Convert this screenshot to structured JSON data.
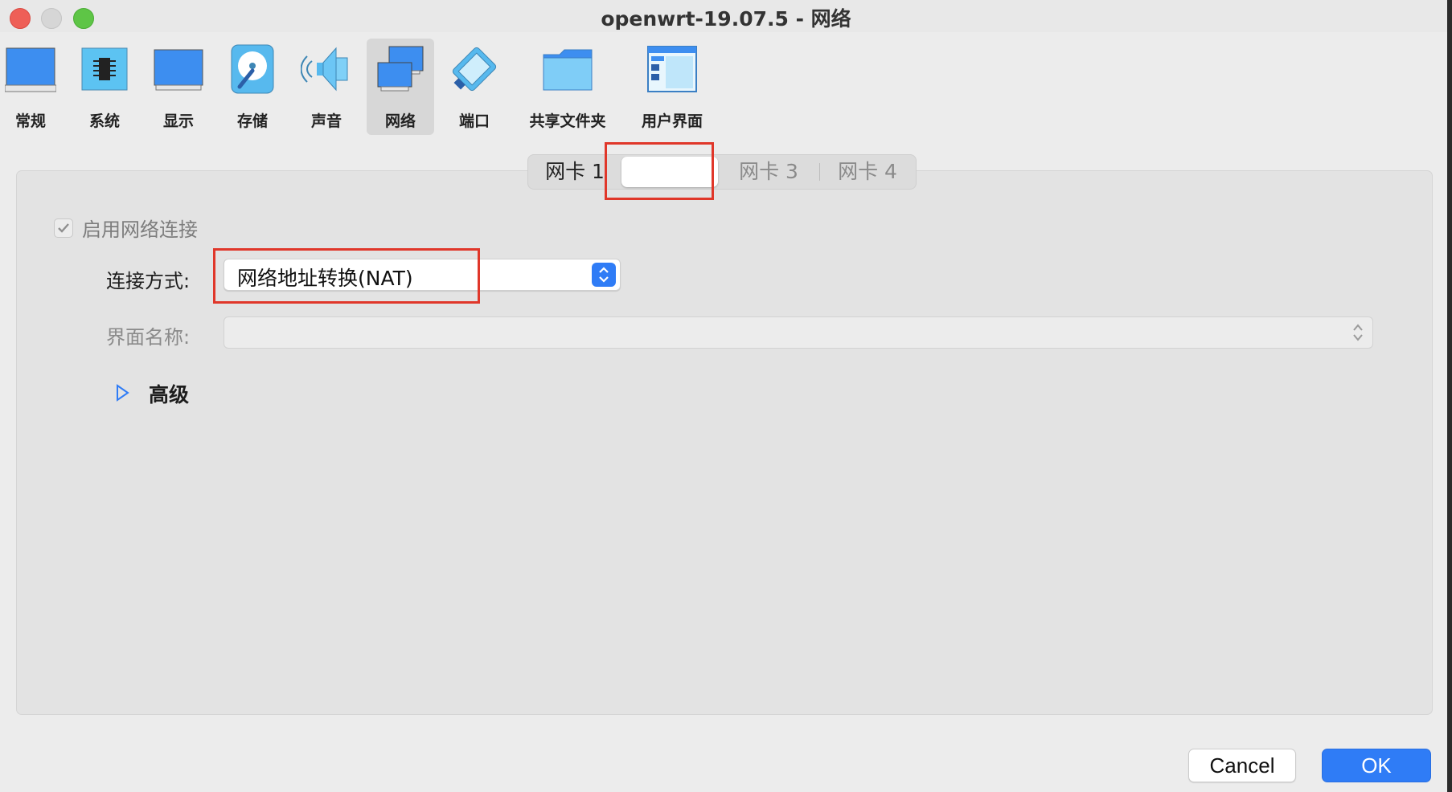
{
  "window": {
    "title": "openwrt-19.07.5 - 网络"
  },
  "toolbar": {
    "items": [
      {
        "label": "常规",
        "icon": "monitor-icon"
      },
      {
        "label": "系统",
        "icon": "chip-icon"
      },
      {
        "label": "显示",
        "icon": "display-icon"
      },
      {
        "label": "存储",
        "icon": "disk-icon"
      },
      {
        "label": "声音",
        "icon": "speaker-icon"
      },
      {
        "label": "网络",
        "icon": "network-icon",
        "selected": true
      },
      {
        "label": "端口",
        "icon": "serial-port-icon"
      },
      {
        "label": "共享文件夹",
        "icon": "folder-icon"
      },
      {
        "label": "用户界面",
        "icon": "ui-window-icon"
      }
    ]
  },
  "tabs": [
    {
      "label": "网卡 1"
    },
    {
      "label": "",
      "selected": true
    },
    {
      "label": "网卡 3"
    },
    {
      "label": "网卡 4"
    }
  ],
  "form": {
    "enable_label": "启用网络连接",
    "enable_checked": true,
    "attach_label": "连接方式:",
    "attach_value": "网络地址转换(NAT)",
    "iface_label": "界面名称:",
    "iface_value": "",
    "advanced_label": "高级"
  },
  "buttons": {
    "cancel": "Cancel",
    "ok": "OK"
  },
  "colors": {
    "accent": "#2f7cf6",
    "highlight": "#e0372a"
  }
}
